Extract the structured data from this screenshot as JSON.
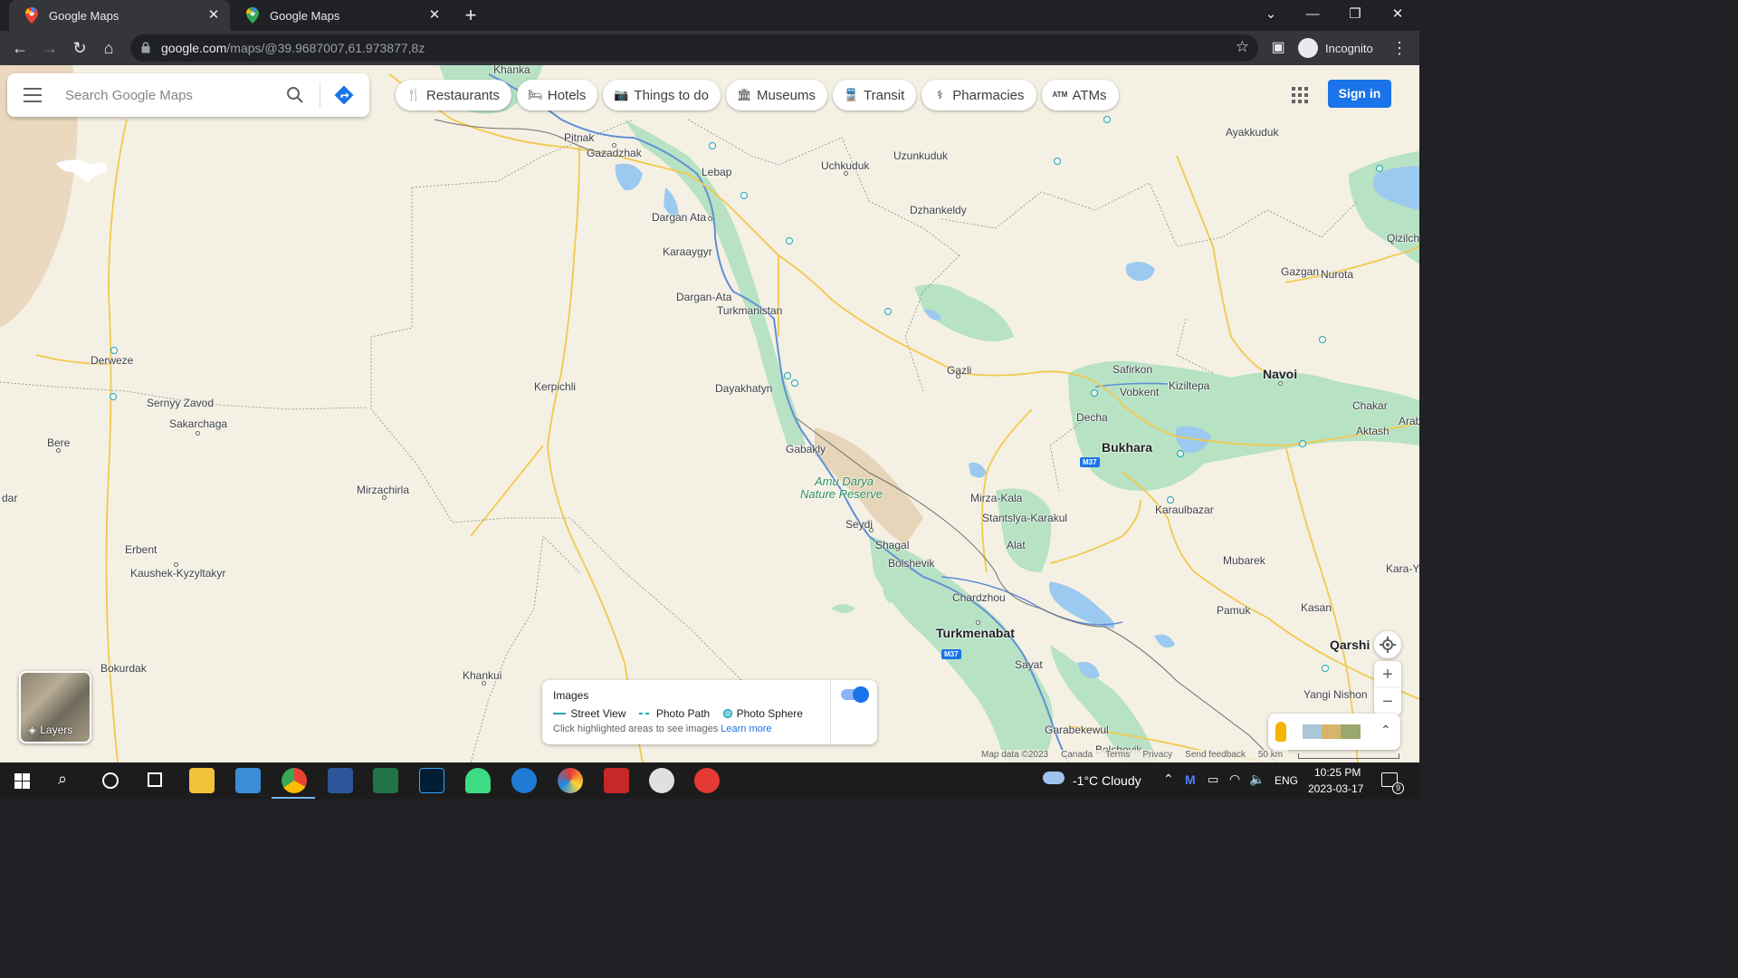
{
  "browser": {
    "tabs": [
      {
        "title": "Google Maps",
        "active": true
      },
      {
        "title": "Google Maps",
        "active": false
      }
    ],
    "url_host": "google.com",
    "url_path": "/maps/@39.9687007,61.973877,8z",
    "profile_label": "Incognito"
  },
  "search": {
    "placeholder": "Search Google Maps"
  },
  "categories": [
    "Restaurants",
    "Hotels",
    "Things to do",
    "Museums",
    "Transit",
    "Pharmacies",
    "ATMs"
  ],
  "signin_label": "Sign in",
  "layers_label": "Layers",
  "images_panel": {
    "title": "Images",
    "legend": [
      "Street View",
      "Photo Path",
      "Photo Sphere"
    ],
    "hint": "Click highlighted areas to see images",
    "learn_more": "Learn more"
  },
  "footer": {
    "map_data": "Map data ©2023",
    "region": "Canada",
    "terms": "Terms",
    "privacy": "Privacy",
    "feedback": "Send feedback",
    "scale": "50 km"
  },
  "places": {
    "khanka": "Khanka",
    "pitnak": "Pitnak",
    "gazadzhak": "Gazadzhak",
    "lebap": "Lebap",
    "uchkuduk": "Uchkuduk",
    "uzunkuduk": "Uzunkuduk",
    "ayakkuduk": "Ayakkuduk",
    "dzhankeldy": "Dzhankeldy",
    "dargan_ata": "Dargan Ata",
    "karaaygyr": "Karaaygyr",
    "dargan_ata2": "Dargan-Ata",
    "turkmanistan": "Turkmanistan",
    "gazgan": "Gazgan",
    "nurota": "Nurota",
    "qizilch": "Qizilch",
    "derweze": "Derweze",
    "safirkon": "Safirkon",
    "navoi": "Navoi",
    "gazli": "Gazli",
    "vobkent": "Vobkent",
    "kiziltepa": "Kiziltepa",
    "kerpichli": "Kerpichli",
    "dayakhatyn": "Dayakhatyn",
    "sernyy_zavod": "Sernyy Zavod",
    "sakarchaga": "Sakarchaga",
    "decha": "Decha",
    "chakar": "Chakar",
    "bukhara": "Bukhara",
    "aktash": "Aktash",
    "arab": "Arab",
    "bere": "Bere",
    "gabakly": "Gabakly",
    "amu_darya_1": "Amu Darya",
    "amu_darya_2": "Nature Reserve",
    "dar": "dar",
    "mirzachirla": "Mirzachirla",
    "mirza_kala": "Mirza-Kala",
    "stantslya": "Stantslya-Karakul",
    "karaulbazar": "Karaulbazar",
    "seydi": "Seydi",
    "erbent": "Erbent",
    "alat": "Alat",
    "shagal": "Shagal",
    "mubarek": "Mubarek",
    "kaushek": "Kaushek-Kyzyltakyr",
    "bolshevik": "Bolshevik",
    "kara_y": "Kara-Y",
    "chardzhou": "Chardzhou",
    "kasan": "Kasan",
    "pamuk": "Pamuk",
    "turkmenabat": "Turkmenabat",
    "qarshi": "Qarshi",
    "bokurdak": "Bokurdak",
    "sayat": "Sayat",
    "yangi_nishon": "Yangi Nishon",
    "khankui": "Khankui",
    "garabekewul": "Garabekewul",
    "bolshevik2": "Bolshevik"
  },
  "road_shields": {
    "m37a": "M37",
    "m37b": "M37"
  },
  "taskbar": {
    "weather": "-1°C  Cloudy",
    "lang": "ENG",
    "time": "10:25 PM",
    "date": "2023-03-17",
    "notif_count": "9"
  },
  "colors": {
    "map_bg": "#f5f0e4",
    "vegetation": "#a8dcb8",
    "water": "#9cc9ef",
    "river": "#5f8fd6",
    "road": "#f2c94c",
    "accent": "#1a73e8"
  }
}
